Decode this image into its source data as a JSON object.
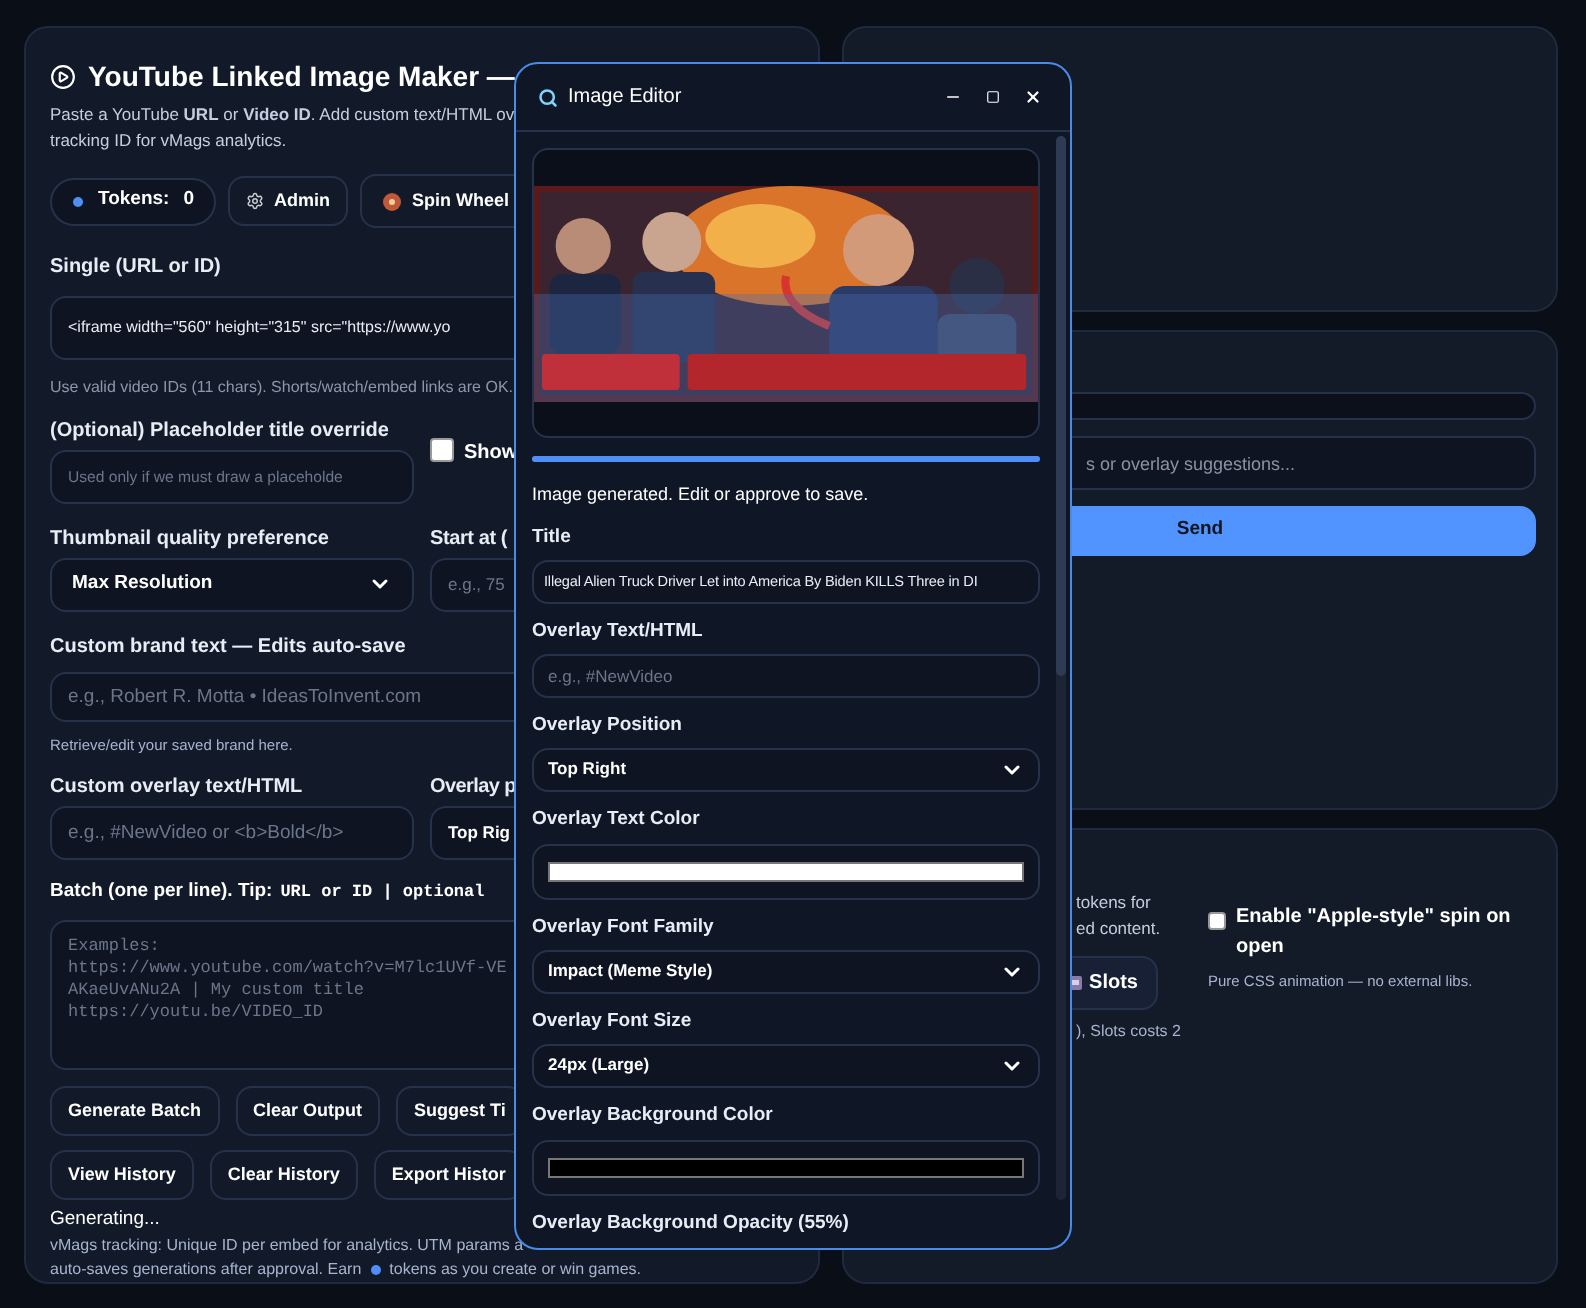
{
  "app": {
    "title": "YouTube Linked Image Maker —",
    "intro_lines": [
      "Paste a YouTube **URL** or **Video ID**. Add custom text/HTML ov",
      "tracking ID for vMags analytics."
    ],
    "tokens": {
      "label": "Tokens:",
      "count": "0"
    },
    "top_buttons": [
      {
        "label": "Admin",
        "kind": "admin"
      },
      {
        "label": "Spin Wheel",
        "kind": "wheel"
      }
    ],
    "single": {
      "label": "Single (URL or ID)",
      "value": "<iframe width=\"560\" height=\"315\" src=\"https://www.yo",
      "hint": "Use valid video IDs (11 chars). Shorts/watch/embed links are OK."
    },
    "placeholder_title": {
      "label": "(Optional) Placeholder title override",
      "placeholder": "Used only if we must draw a placeholde",
      "checkbox": {
        "label": "Show",
        "checked": false
      }
    },
    "quality": {
      "label": "Thumbnail quality preference",
      "value": "Max Resolution"
    },
    "start_at": {
      "label": "Start at (",
      "placeholder": "e.g., 75"
    },
    "brand": {
      "label": "Custom brand text — Edits auto-save",
      "placeholder": "e.g., Robert R. Motta • IdeasToInvent.com",
      "hint": "Retrieve/edit your saved brand here."
    },
    "overlay_text": {
      "label": "Custom overlay text/HTML",
      "placeholder": "e.g., #NewVideo or <b>Bold</b>"
    },
    "overlay_position": {
      "label": "Overlay p",
      "value": "Top Rig"
    },
    "batch": {
      "label": "Batch (one per line). Tip:",
      "code": "URL or ID | optional",
      "placeholder": "Examples:\nhttps://www.youtube.com/watch?v=M7lc1UVf-VE\nAKaeUvANu2A | My custom title\nhttps://youtu.be/VIDEO_ID"
    },
    "button_rows": [
      [
        "Generate Batch",
        "Clear Output",
        "Suggest Ti"
      ],
      [
        "View History",
        "Clear History",
        "Export Histor"
      ]
    ],
    "status": "Generating...",
    "footer": {
      "line1": "vMags tracking: Unique ID per embed for analytics. UTM params a",
      "line2_before": "auto-saves generations after approval. Earn",
      "line2_after": "tokens as you create or win games."
    }
  },
  "chat_panel": {
    "placeholder": "s or overlay suggestions...",
    "send": "Send"
  },
  "games_panel": {
    "lines": [
      "tokens for",
      "ed content."
    ],
    "slots": "Slots",
    "caption": "), Slots costs 2",
    "apple_spin": {
      "label": "Enable \"Apple-style\" spin on open",
      "checked": false,
      "hint": "Pure CSS animation — no external libs."
    }
  },
  "editor": {
    "title": "Image Editor",
    "progress": {
      "level": 1
    },
    "status": "Image generated. Edit or approve to save.",
    "fields": [
      {
        "kind": "input",
        "label": "Title",
        "value": "Illegal Alien Truck Driver Let into America By Biden KILLS Three in DI"
      },
      {
        "kind": "input",
        "label": "Overlay Text/HTML",
        "placeholder": "e.g., #NewVideo"
      },
      {
        "kind": "select",
        "label": "Overlay Position",
        "value": "Top Right"
      },
      {
        "kind": "color",
        "label": "Overlay Text Color",
        "color": "#ffffff"
      },
      {
        "kind": "select",
        "label": "Overlay Font Family",
        "value": "Impact (Meme Style)"
      },
      {
        "kind": "select",
        "label": "Overlay Font Size",
        "value": "24px (Large)"
      },
      {
        "kind": "color",
        "label": "Overlay Background Color",
        "color": "#000000"
      },
      {
        "kind": "label",
        "label": "Overlay Background Opacity (55%)"
      }
    ]
  }
}
